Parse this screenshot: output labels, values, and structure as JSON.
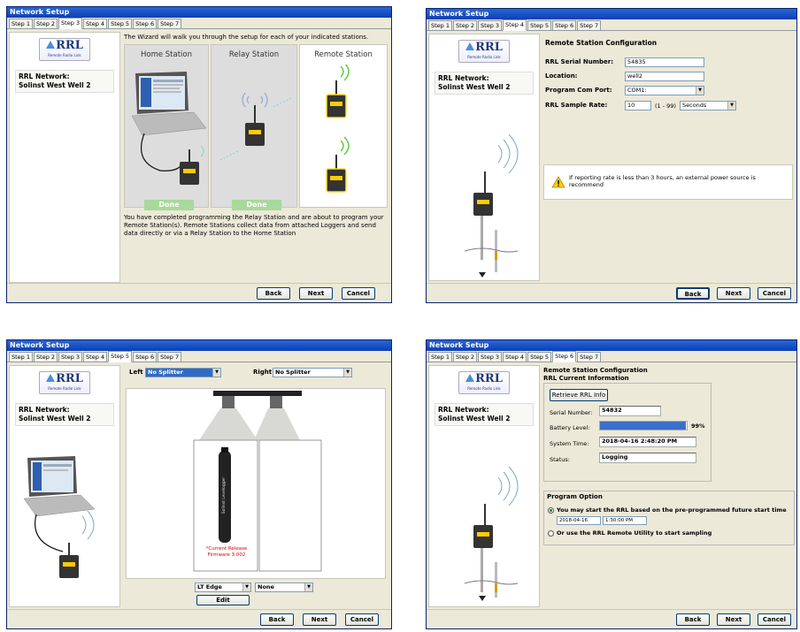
{
  "windows": [
    {
      "title": "Network Setup",
      "tabs": [
        "Step 1",
        "Step 2",
        "Step 3",
        "Step 4",
        "Step 5",
        "Step 6",
        "Step 7"
      ],
      "active_tab": 2,
      "network_label": "RRL Network:",
      "network_name": "Solinst West Well 2",
      "intro": "The Wizard will walk you through the setup for each of your indicated stations.",
      "columns": [
        "Home Station",
        "Relay Station",
        "Remote Station"
      ],
      "done_label": "Done",
      "description": "You have completed programming the Relay Station and are about to program your Remote Station(s). Remote Stations collect data from attached Loggers and send data directly or via a Relay Station to the Home Station",
      "buttons": {
        "back": "Back",
        "next": "Next",
        "cancel": "Cancel"
      }
    },
    {
      "title": "Network Setup",
      "tabs": [
        "Step 1",
        "Step 2",
        "Step 3",
        "Step 4",
        "Step 5",
        "Step 6",
        "Step 7"
      ],
      "active_tab": 3,
      "network_label": "RRL Network:",
      "network_name": "Solinst West Well 2",
      "heading": "Remote Station Configuration",
      "serial_label": "RRL Serial Number:",
      "serial_value": "54835",
      "location_label": "Location:",
      "location_value": "well2",
      "port_label": "Program Com Port:",
      "port_value": "COM1:",
      "rate_label": "RRL Sample Rate:",
      "rate_value": "10",
      "rate_range": "(1 - 99)",
      "rate_unit": "Seconds",
      "warning": "If reporting rate is less than 3 hours, an external power source is recommend",
      "buttons": {
        "back": "Back",
        "next": "Next",
        "cancel": "Cancel"
      }
    },
    {
      "title": "Network Setup",
      "tabs": [
        "Step 1",
        "Step 2",
        "Step 3",
        "Step 4",
        "Step 5",
        "Step 6",
        "Step 7"
      ],
      "active_tab": 4,
      "network_label": "RRL Network:",
      "network_name": "Solinst West Well 2",
      "left_label": "Left",
      "left_value": "No Splitter",
      "right_label": "Right",
      "right_value": "No Splitter",
      "logger_text": "Solinst Levelogger",
      "firmware_note": "*Current Release Firmware 3.002",
      "logger_left": "LT Edge",
      "logger_right": "None",
      "edit_label": "Edit",
      "buttons": {
        "back": "Back",
        "next": "Next",
        "cancel": "Cancel"
      }
    },
    {
      "title": "Network Setup",
      "tabs": [
        "Step 1",
        "Step 2",
        "Step 3",
        "Step 4",
        "Step 5",
        "Step 6",
        "Step 7"
      ],
      "active_tab": 5,
      "network_label": "RRL Network:",
      "network_name": "Solinst West Well 2",
      "heading": "Remote Station Configuration",
      "subheading": "RRL Current Information",
      "retrieve_label": "Retrieve RRL Info",
      "serial_label": "Serial Number:",
      "serial_value": "54832",
      "battery_label": "Battery Level:",
      "battery_percent": "99%",
      "battery_fraction": 0.99,
      "time_label": "System Time:",
      "time_value": "2018-04-16 2:48:20 PM",
      "status_label": "Status:",
      "status_value": "Logging",
      "option_heading": "Program Option",
      "option1": "You may start the RRL based on the pre-programmed future start time",
      "option1_date": "2018-04-16",
      "option1_time": "1:30:00 PM",
      "option2": "Or use the RRL Remote Utility to start sampling",
      "buttons": {
        "back": "Back",
        "next": "Next",
        "cancel": "Cancel"
      }
    }
  ],
  "logo": {
    "text": "RRL",
    "subtitle": "Remote Radio Link"
  },
  "colors": {
    "title_bar": "#0b3fb5",
    "done": "#a7d99a",
    "battery": "#3b6fc9"
  }
}
